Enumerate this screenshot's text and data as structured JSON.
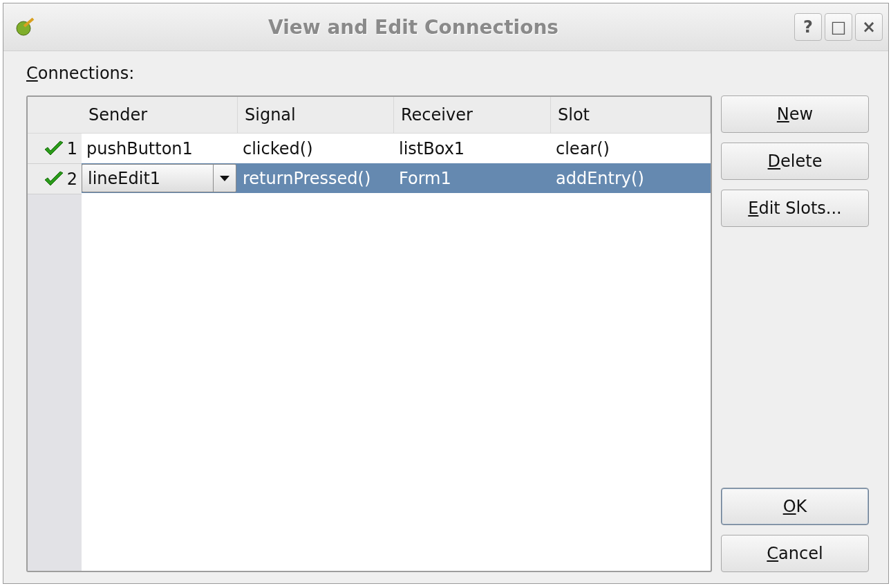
{
  "window": {
    "title": "View and Edit Connections",
    "controls": [
      "?",
      "□",
      "×"
    ]
  },
  "label": "Connections:",
  "table": {
    "columns": [
      "Sender",
      "Signal",
      "Receiver",
      "Slot"
    ],
    "rows": [
      {
        "number": "1",
        "valid": true,
        "selected": false,
        "editing": false,
        "cells": [
          "pushButton1",
          "clicked()",
          "listBox1",
          "clear()"
        ]
      },
      {
        "number": "2",
        "valid": true,
        "selected": true,
        "editing": true,
        "cells": [
          "lineEdit1",
          "returnPressed()",
          "Form1",
          "addEntry()"
        ]
      }
    ]
  },
  "actions": [
    {
      "label": "New",
      "default": false
    },
    {
      "label": "Delete",
      "default": false
    },
    {
      "label": "Edit Slots...",
      "default": false
    }
  ],
  "dialog_buttons": [
    {
      "label": "OK",
      "default": true
    },
    {
      "label": "Cancel",
      "default": false
    }
  ]
}
